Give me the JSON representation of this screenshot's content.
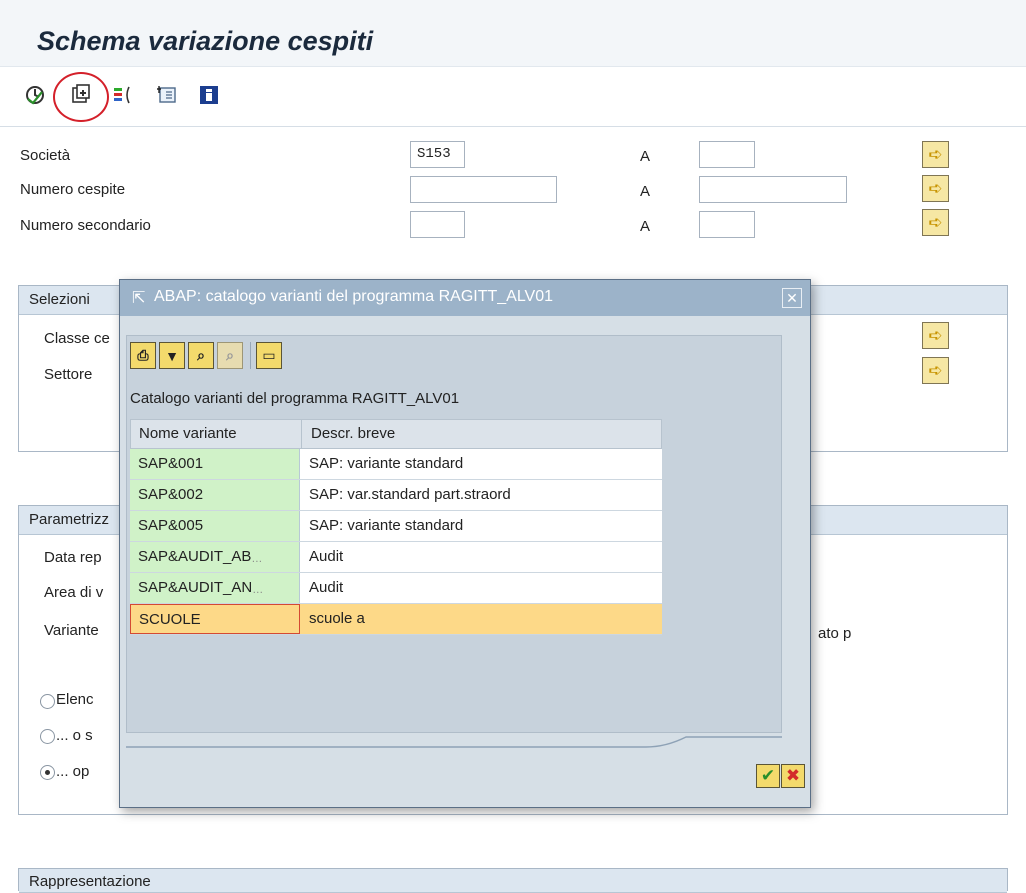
{
  "window": {
    "title": "Schema variazione cespiti"
  },
  "toolbar": {
    "icons": [
      "execute-icon",
      "get-variant-icon",
      "dynamic-selections-icon",
      "selection-options-icon",
      "info-icon"
    ]
  },
  "selection": {
    "rows": [
      {
        "label": "Società",
        "from": "S153",
        "to_label": "A",
        "to": ""
      },
      {
        "label": "Numero cespite",
        "from": "",
        "to_label": "A",
        "to": ""
      },
      {
        "label": "Numero secondario",
        "from": "",
        "to_label": "A",
        "to": ""
      }
    ]
  },
  "groups": {
    "selezioni": {
      "title": "Selezioni",
      "rows": [
        "Classe ce",
        "Settore"
      ]
    },
    "parametri": {
      "title": "Parametrizz",
      "rows": [
        "Data rep",
        "Area di v",
        "Variante"
      ],
      "trailing_text": "ato p"
    },
    "options": [
      "Elenc",
      "... o s",
      "... op"
    ],
    "rappresentazione": {
      "title": "Rappresentazione"
    }
  },
  "dialog": {
    "title": "ABAP: catalogo varianti del programma RAGITT_ALV01",
    "heading": "Catalogo varianti del programma RAGITT_ALV01",
    "columns": [
      "Nome variante",
      "Descr. breve"
    ],
    "rows": [
      {
        "name": "SAP&001",
        "desc": "SAP: variante standard"
      },
      {
        "name": "SAP&002",
        "desc": "SAP: var.standard part.straord"
      },
      {
        "name": "SAP&005",
        "desc": "SAP: variante standard"
      },
      {
        "name": "SAP&AUDIT_AB",
        "desc": "Audit"
      },
      {
        "name": "SAP&AUDIT_AN",
        "desc": "Audit"
      },
      {
        "name": "SCUOLE",
        "desc": "scuole a"
      }
    ],
    "selected_row": 5
  }
}
